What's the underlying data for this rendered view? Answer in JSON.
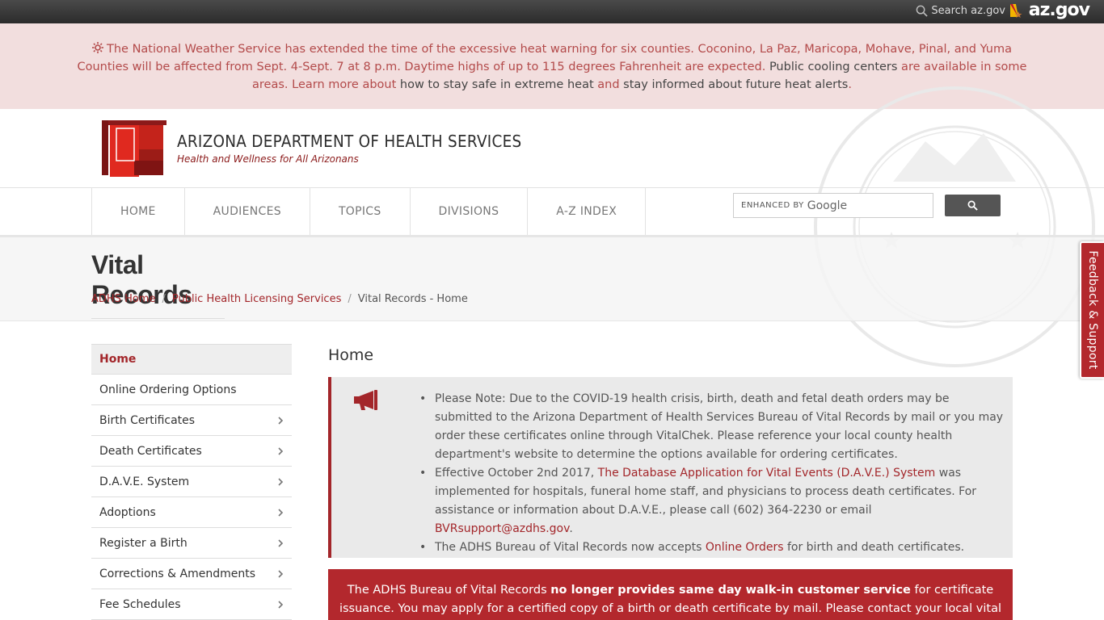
{
  "topbar": {
    "search_label": "Search az.gov",
    "logo_text": "az.gov"
  },
  "alert": {
    "line1": "The National Weather Service has extended the time of the excessive heat warning for six counties. Coconino, La Paz, Maricopa, Mohave, Pinal, and Yuma",
    "line2_a": "Counties will be affected from Sept. 4-Sept. 7 at 8 p.m. Daytime highs of up to 115 degrees Fahrenheit are expected. ",
    "line2_b": "Public cooling centers",
    "line2_c": " are available in some",
    "line3_a": "areas. Learn more about ",
    "line3_b": "how to stay safe in extreme heat",
    "line3_c": " and ",
    "line3_d": "stay informed about future heat alerts",
    "line3_e": "."
  },
  "header": {
    "title": "ARIZONA DEPARTMENT OF HEALTH SERVICES",
    "subtitle": "Health and Wellness for All Arizonans"
  },
  "nav": {
    "items": [
      "HOME",
      "AUDIENCES",
      "TOPICS",
      "DIVISIONS",
      "A-Z INDEX"
    ],
    "search_enhanced": "ENHANCED BY",
    "search_google": "Google"
  },
  "page": {
    "title": "Vital Records",
    "breadcrumbs": [
      "ADHS Home",
      "Public Health Licensing Services",
      "Vital Records - Home"
    ]
  },
  "sidebar": {
    "items": [
      "Home",
      "Online Ordering Options",
      "Birth Certificates",
      "Death Certificates",
      "D.A.V.E. System",
      "Adoptions",
      "Register a Birth",
      "Corrections & Amendments",
      "Fee Schedules"
    ]
  },
  "main": {
    "heading": "Home",
    "notice": {
      "b1": "Please Note: Due to the COVID-19 health crisis, birth, death and fetal death orders may be submitted to the Arizona Department of Health Services Bureau of Vital Records by mail or you may order these certificates online through VitalChek. Please reference your local county health department's website to determine the options available for ordering certificates.",
      "b2_a": "Effective October 2nd 2017, ",
      "b2_link": "The Database Application for Vital Events (D.A.V.E.) System",
      "b2_b": " was implemented for hospitals, funeral home staff, and physicians to process death certificates. For assistance or information about D.A.V.E., please call (602) 364-2230 or email ",
      "b2_email": "BVRsupport@azdhs.gov",
      "b2_c": ".",
      "b3_a": "The ADHS Bureau of Vital Records now accepts ",
      "b3_link": "Online Orders",
      "b3_b": " for birth and death certificates."
    },
    "redbox": {
      "a": "The ADHS Bureau of Vital Records ",
      "bold": "no longer provides same day walk-in customer service",
      "b": " for certificate issuance. You may apply for a certified copy of a birth or death certificate by mail. Please contact your local vital records office to"
    }
  },
  "feedback": {
    "label": "Feedback & Support"
  },
  "colors": {
    "brand_red": "#a3262a",
    "alert_bg": "#f2dede",
    "alert_text": "#b34a4a"
  }
}
